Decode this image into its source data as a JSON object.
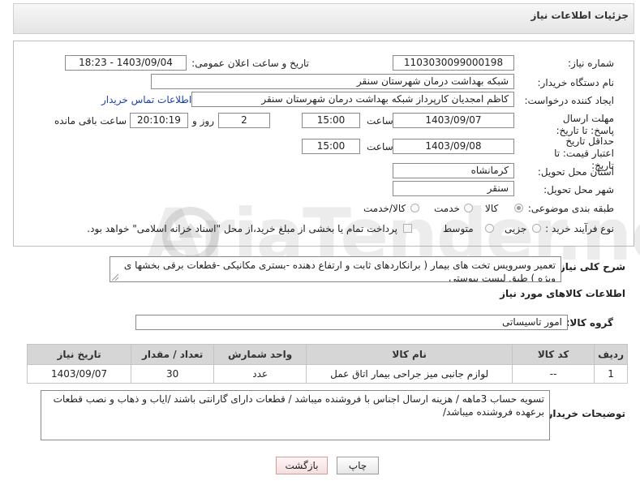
{
  "header": {
    "title": "جزئیات اطلاعات نیاز"
  },
  "form": {
    "need_number": {
      "label": "شماره نیاز:",
      "value": "1103030099000198"
    },
    "announce": {
      "label": "تاریخ و ساعت اعلان عمومی:",
      "value": "1403/09/04 - 18:23"
    },
    "buyer_org": {
      "label": "نام دستگاه خریدار:",
      "value": "شبکه بهداشت درمان شهرستان سنقر"
    },
    "requester": {
      "label": "ایجاد کننده درخواست:",
      "value": "کاظم امجدیان کارپرداز شبکه بهداشت درمان شهرستان سنقر",
      "contact_link": "اطلاعات تماس خریدار"
    },
    "deadline": {
      "label": "مهلت ارسال پاسخ: تا تاریخ:",
      "date": "1403/09/07",
      "time_label": "ساعت",
      "time": "15:00",
      "days": "2",
      "days_label": "روز و",
      "remaining": "20:10:19",
      "remaining_label": "ساعت باقی مانده"
    },
    "price_validity": {
      "label": "حداقل تاریخ اعتبار قیمت: تا تاریخ:",
      "date": "1403/09/08",
      "time_label": "ساعت",
      "time": "15:00"
    },
    "province": {
      "label": "استان محل تحویل:",
      "value": "کرمانشاه"
    },
    "city": {
      "label": "شهر محل تحویل:",
      "value": "سنقر"
    },
    "category": {
      "label": "طبقه بندی موضوعی:",
      "options": [
        "کالا",
        "خدمت",
        "کالا/خدمت"
      ],
      "selected": "کالا"
    },
    "purchase_type": {
      "label": "نوع فرآیند خرید :",
      "options": [
        "جزیی",
        "متوسط"
      ],
      "payment_note": "پرداخت تمام یا بخشی از مبلغ خرید،از محل \"اسناد خزانه اسلامی\" خواهد بود."
    }
  },
  "description": {
    "label": "شرح کلی نیاز:",
    "value": "تعمیر وسرویس تخت های بیمار ( برانکاردهای ثابت و ارتفاع دهنده -بستری مکانیکی -قطعات برقی بخشها ی ویژه ) طبق لیست پیوستی"
  },
  "goods": {
    "section_title": "اطلاعات کالاهای مورد نیاز",
    "group_label": "گروه کالا:",
    "group_value": "امور تاسیساتی",
    "columns": [
      "ردیف",
      "کد کالا",
      "نام کالا",
      "واحد شمارش",
      "تعداد / مقدار",
      "تاریخ نیاز"
    ],
    "rows": [
      [
        "1",
        "--",
        "لوازم جانبی میز جراحی بیمار اتاق عمل",
        "عدد",
        "30",
        "1403/09/07"
      ]
    ]
  },
  "buyer_notes": {
    "label": "توضیحات خریدار:",
    "value": "تسویه حساب 3ماهه / هزینه ارسال اجناس با فروشنده میباشد /  قطعات دارای گارانتی  باشند /ایاب و ذهاب و نصب قطعات برعهده فروشنده میباشد/"
  },
  "buttons": {
    "print": "چاپ",
    "back": "بازگشت"
  },
  "watermark": {
    "text": "AriaTender.neT"
  },
  "colors": {
    "link": "#1a3fb0",
    "table_header": "#d6d6d6",
    "back_button": "#f4dede"
  }
}
